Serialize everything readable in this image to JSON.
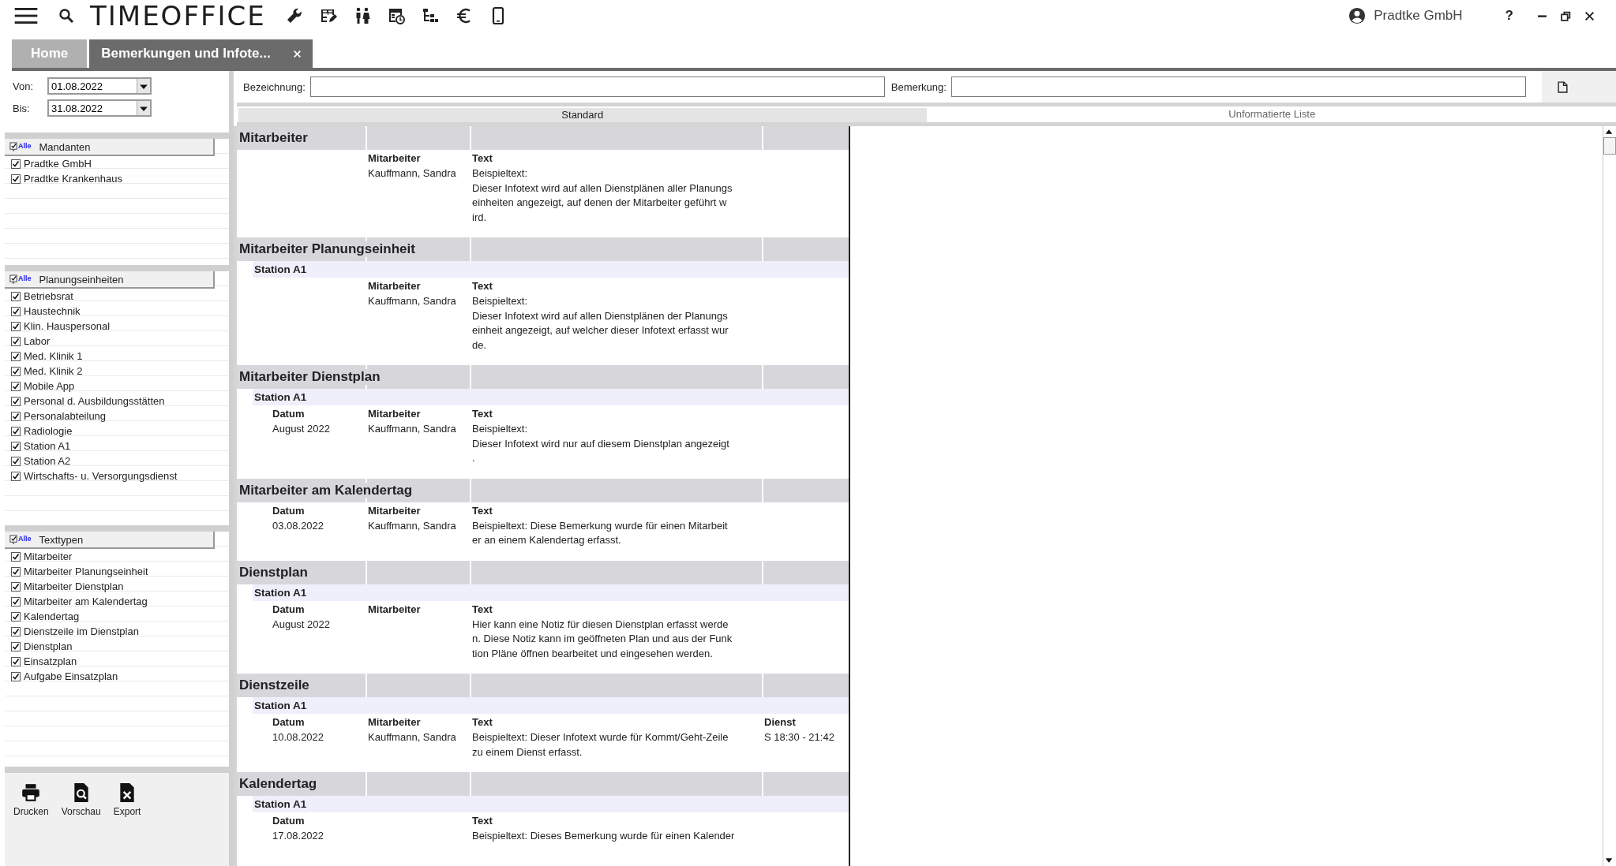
{
  "app": {
    "logo": "TIMEOFFICE",
    "account": "Pradtke GmbH",
    "help": "?"
  },
  "tabs": [
    {
      "label": "Home",
      "selected": false,
      "closable": false
    },
    {
      "label": "Bemerkungen und Infote...",
      "selected": true,
      "closable": true
    }
  ],
  "filters": {
    "von_label": "Von:",
    "von": "01.08.2022",
    "bis_label": "Bis:",
    "bis": "31.08.2022"
  },
  "lists": [
    {
      "title": "Mandanten",
      "select_all": "Alle",
      "items": [
        {
          "label": "Pradtke GmbH",
          "checked": true
        },
        {
          "label": "Pradtke Krankenhaus",
          "checked": true
        }
      ]
    },
    {
      "title": "Planungseinheiten",
      "select_all": "Alle",
      "items": [
        {
          "label": "Betriebsrat",
          "checked": true
        },
        {
          "label": "Haustechnik",
          "checked": true
        },
        {
          "label": "Klin. Hauspersonal",
          "checked": true
        },
        {
          "label": "Labor",
          "checked": true
        },
        {
          "label": "Med. Klinik 1",
          "checked": true
        },
        {
          "label": "Med. Klinik 2",
          "checked": true
        },
        {
          "label": "Mobile App",
          "checked": true
        },
        {
          "label": "Personal d. Ausbildungsstätten",
          "checked": true
        },
        {
          "label": "Personalabteilung",
          "checked": true
        },
        {
          "label": "Radiologie",
          "checked": true
        },
        {
          "label": "Station A1",
          "checked": true
        },
        {
          "label": "Station A2",
          "checked": true
        },
        {
          "label": "Wirtschafts- u. Versorgungsdienst",
          "checked": true
        }
      ]
    },
    {
      "title": "Texttypen",
      "select_all": "Alle",
      "items": [
        {
          "label": "Mitarbeiter",
          "checked": true
        },
        {
          "label": "Mitarbeiter Planungseinheit",
          "checked": true
        },
        {
          "label": "Mitarbeiter Dienstplan",
          "checked": true
        },
        {
          "label": "Mitarbeiter am Kalendertag",
          "checked": true
        },
        {
          "label": "Kalendertag",
          "checked": true
        },
        {
          "label": "Dienstzeile im Dienstplan",
          "checked": true
        },
        {
          "label": "Dienstplan",
          "checked": true
        },
        {
          "label": "Einsatzplan",
          "checked": true
        },
        {
          "label": "Aufgabe Einsatzplan",
          "checked": true
        }
      ]
    }
  ],
  "actions": [
    {
      "kind": "print",
      "label": "Drucken"
    },
    {
      "kind": "preview",
      "label": "Vorschau"
    },
    {
      "kind": "export",
      "label": "Export"
    }
  ],
  "search": {
    "bezeichnung_label": "Bezeichnung:",
    "bemerkung_label": "Bemerkung:"
  },
  "view_tabs": [
    {
      "label": "Standard",
      "selected": true
    },
    {
      "label": "Unformatierte Liste",
      "selected": false
    }
  ],
  "report": [
    {
      "title": "Mitarbeiter",
      "headers": {
        "mitarbeiter": "Mitarbeiter",
        "text": "Text"
      },
      "rows": [
        {
          "mitarbeiter": "Kauffmann, Sandra",
          "text": "Beispieltext:\nDieser Infotext wird auf allen Dienstplänen aller Planungs\neinheiten angezeigt, auf denen der Mitarbeiter geführt w\nird."
        }
      ]
    },
    {
      "title": "Mitarbeiter Planungseinheit",
      "station": "Station A1",
      "headers": {
        "mitarbeiter": "Mitarbeiter",
        "text": "Text"
      },
      "rows": [
        {
          "mitarbeiter": "Kauffmann, Sandra",
          "text": "Beispieltext:\nDieser Infotext wird auf allen Dienstplänen der Planungs\neinheit angezeigt, auf welcher dieser Infotext erfasst wur\nde."
        }
      ]
    },
    {
      "title": "Mitarbeiter Dienstplan",
      "station": "Station A1",
      "headers": {
        "datum": "Datum",
        "mitarbeiter": "Mitarbeiter",
        "text": "Text"
      },
      "rows": [
        {
          "datum": "August 2022",
          "mitarbeiter": "Kauffmann, Sandra",
          "text": "Beispieltext:\nDieser Infotext wird nur auf diesem Dienstplan angezeigt\n."
        }
      ]
    },
    {
      "title": "Mitarbeiter am Kalendertag",
      "headers": {
        "datum": "Datum",
        "mitarbeiter": "Mitarbeiter",
        "text": "Text"
      },
      "rows": [
        {
          "datum": "03.08.2022",
          "mitarbeiter": "Kauffmann, Sandra",
          "text": "Beispieltext: Diese Bemerkung wurde für einen Mitarbeit\ner an einem Kalendertag erfasst."
        }
      ]
    },
    {
      "title": "Dienstplan",
      "station": "Station A1",
      "headers": {
        "datum": "Datum",
        "mitarbeiter": "Mitarbeiter",
        "text": "Text"
      },
      "rows": [
        {
          "datum": "August 2022",
          "text": "Hier kann eine Notiz für diesen Dienstplan erfasst werde\nn. Diese Notiz kann im geöffneten Plan und aus der Funk\ntion Pläne öffnen bearbeitet und eingesehen werden."
        }
      ]
    },
    {
      "title": "Dienstzeile",
      "station": "Station A1",
      "headers": {
        "datum": "Datum",
        "mitarbeiter": "Mitarbeiter",
        "text": "Text",
        "dienst": "Dienst"
      },
      "rows": [
        {
          "datum": "10.08.2022",
          "mitarbeiter": "Kauffmann, Sandra",
          "text": "Beispieltext: Dieser Infotext wurde für Kommt/Geht-Zeile\nzu einem Dienst erfasst.",
          "dienst": "S 18:30 - 21:42"
        }
      ]
    },
    {
      "title": "Kalendertag",
      "station": "Station A1",
      "headers": {
        "datum": "Datum",
        "text": "Text"
      },
      "rows": [
        {
          "datum": "17.08.2022",
          "text": "Beispieltext: Dieses Bemerkung wurde für einen Kalender"
        }
      ]
    }
  ]
}
